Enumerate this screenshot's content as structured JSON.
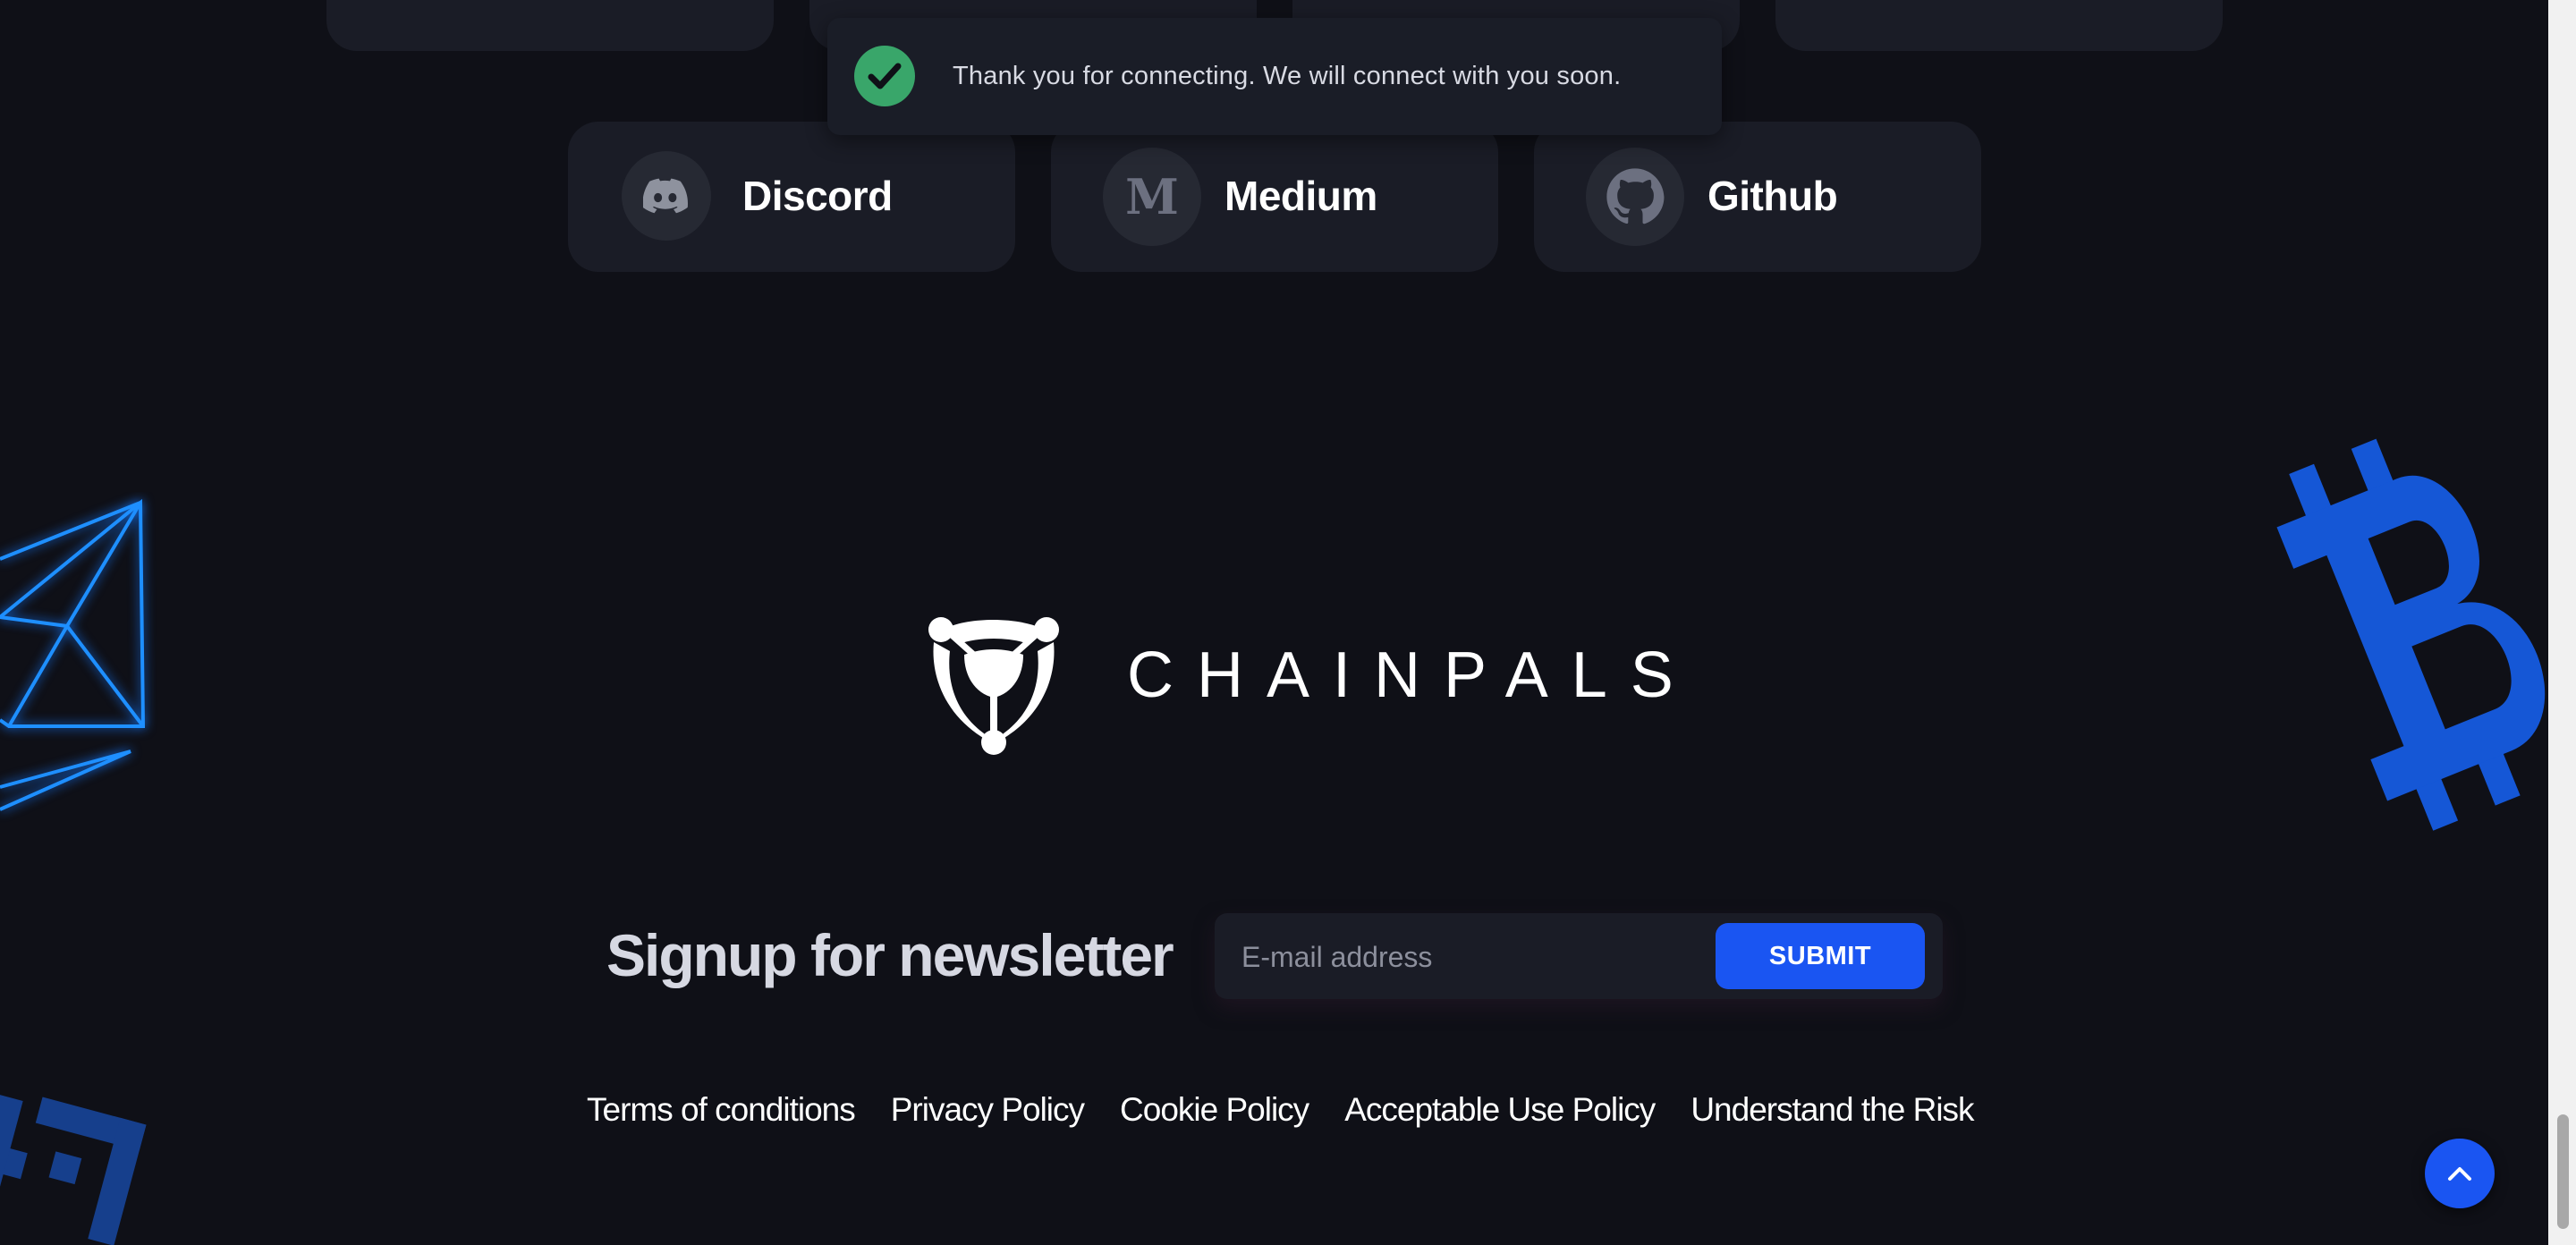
{
  "toast": {
    "message": "Thank you for connecting. We will connect with you soon.",
    "icon": "check-circle-icon",
    "color": "#39a66a"
  },
  "social": {
    "row1_partial": [
      {
        "icon": "social-icon"
      },
      {
        "icon": "social-icon"
      },
      {
        "icon": "social-icon"
      },
      {
        "icon": "social-icon"
      }
    ],
    "row2": [
      {
        "label": "Discord",
        "icon": "discord-icon"
      },
      {
        "label": "Medium",
        "icon": "medium-icon"
      },
      {
        "label": "Github",
        "icon": "github-icon"
      }
    ]
  },
  "brand": {
    "name": "CHAINPALS",
    "logo_icon": "chainpals-logo-icon"
  },
  "newsletter": {
    "title": "Signup for newsletter",
    "email_placeholder": "E-mail address",
    "email_value": "",
    "submit_label": "SUBMIT"
  },
  "footer": {
    "links": [
      "Terms of conditions",
      "Privacy Policy",
      "Cookie Policy",
      "Acceptable Use Policy",
      "Understand the Risk"
    ]
  },
  "scroll_top": {
    "icon": "chevron-up-icon"
  },
  "decorations": {
    "left": "ethereum-outline-icon",
    "right": "bitcoin-icon",
    "bottom_left": "binance-icon"
  },
  "colors": {
    "background": "#0f1017",
    "card": "#1a1c26",
    "accent": "#1a55f2",
    "success": "#39a66a"
  }
}
